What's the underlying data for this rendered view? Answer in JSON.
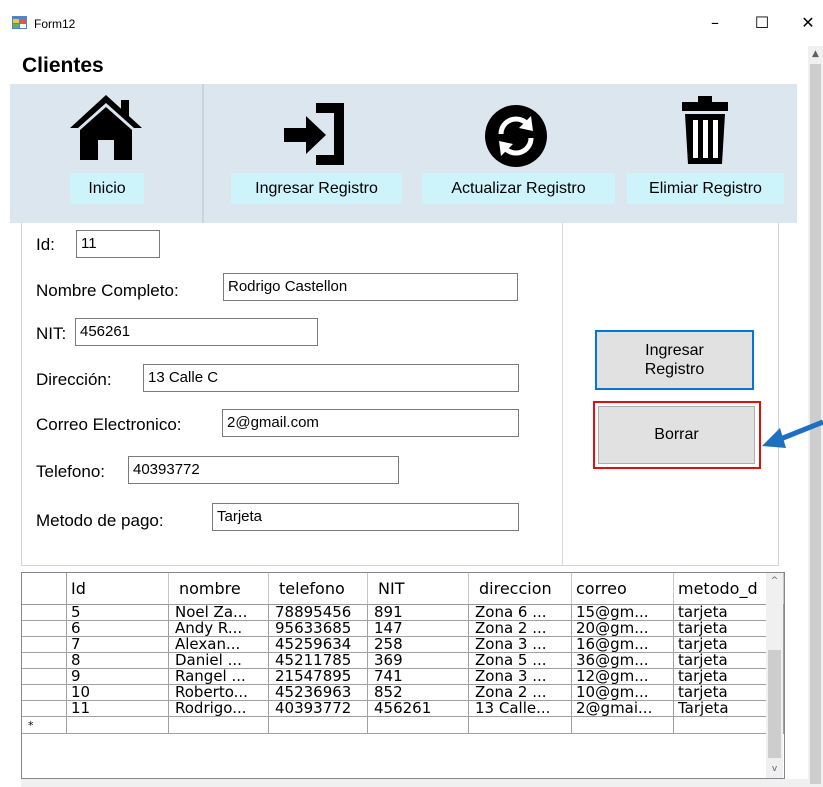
{
  "window": {
    "title": "Form12",
    "minimize_glyph": "–",
    "maximize_glyph": "☐",
    "close_glyph": "✕"
  },
  "heading": "Clientes",
  "toolbar": {
    "items": [
      {
        "label": "Inicio",
        "icon": "home-icon"
      },
      {
        "label": "Ingresar Registro",
        "icon": "sign-in-icon"
      },
      {
        "label": "Actualizar Registro",
        "icon": "refresh-icon"
      },
      {
        "label": "Elimiar Registro",
        "icon": "trash-icon"
      }
    ]
  },
  "form": {
    "id_label": "Id:",
    "id_value": "11",
    "nombre_label": "Nombre Completo:",
    "nombre_value": "Rodrigo Castellon",
    "nit_label": "NIT:",
    "nit_value": "456261",
    "direccion_label": "Dirección:",
    "direccion_value": "13 Calle C",
    "correo_label": "Correo Electronico:",
    "correo_value": "2@gmail.com",
    "telefono_label": "Telefono:",
    "telefono_value": "40393772",
    "metodo_label": "Metodo de pago:",
    "metodo_value": "Tarjeta"
  },
  "buttons": {
    "ingresar": "Ingresar Registro",
    "borrar": "Borrar"
  },
  "grid": {
    "columns": [
      "Id",
      "nombre",
      "telefono",
      "NIT",
      "direccion",
      "correo",
      "metodo_d"
    ],
    "rows": [
      [
        "5",
        "Noel Za...",
        "78895456",
        "891",
        "Zona 6 ...",
        "15@gm...",
        "tarjeta"
      ],
      [
        "6",
        "Andy R...",
        "95633685",
        "147",
        "Zona 2 ...",
        "20@gm...",
        "tarjeta"
      ],
      [
        "7",
        "Alexan...",
        "45259634",
        "258",
        "Zona 3 ...",
        "16@gm...",
        "tarjeta"
      ],
      [
        "8",
        "Daniel ...",
        "45211785",
        "369",
        "Zona 5 ...",
        "36@gm...",
        "tarjeta"
      ],
      [
        "9",
        "Rangel ...",
        "21547895",
        "741",
        "Zona 3 ...",
        "12@gm...",
        "tarjeta"
      ],
      [
        "10",
        "Roberto...",
        "45236963",
        "852",
        "Zona 2 ...",
        "10@gm...",
        "tarjeta"
      ],
      [
        "11",
        "Rodrigo...",
        "40393772",
        "456261",
        "13 Calle...",
        "2@gmai...",
        "Tarjeta"
      ]
    ],
    "new_row_marker": "*"
  },
  "colors": {
    "toolbar_bg": "#dbe6ee",
    "label_bg": "#cdf3fb",
    "focus_border": "#0078d7",
    "highlight_red": "#e01010",
    "arrow_blue": "#1f6fc0"
  }
}
